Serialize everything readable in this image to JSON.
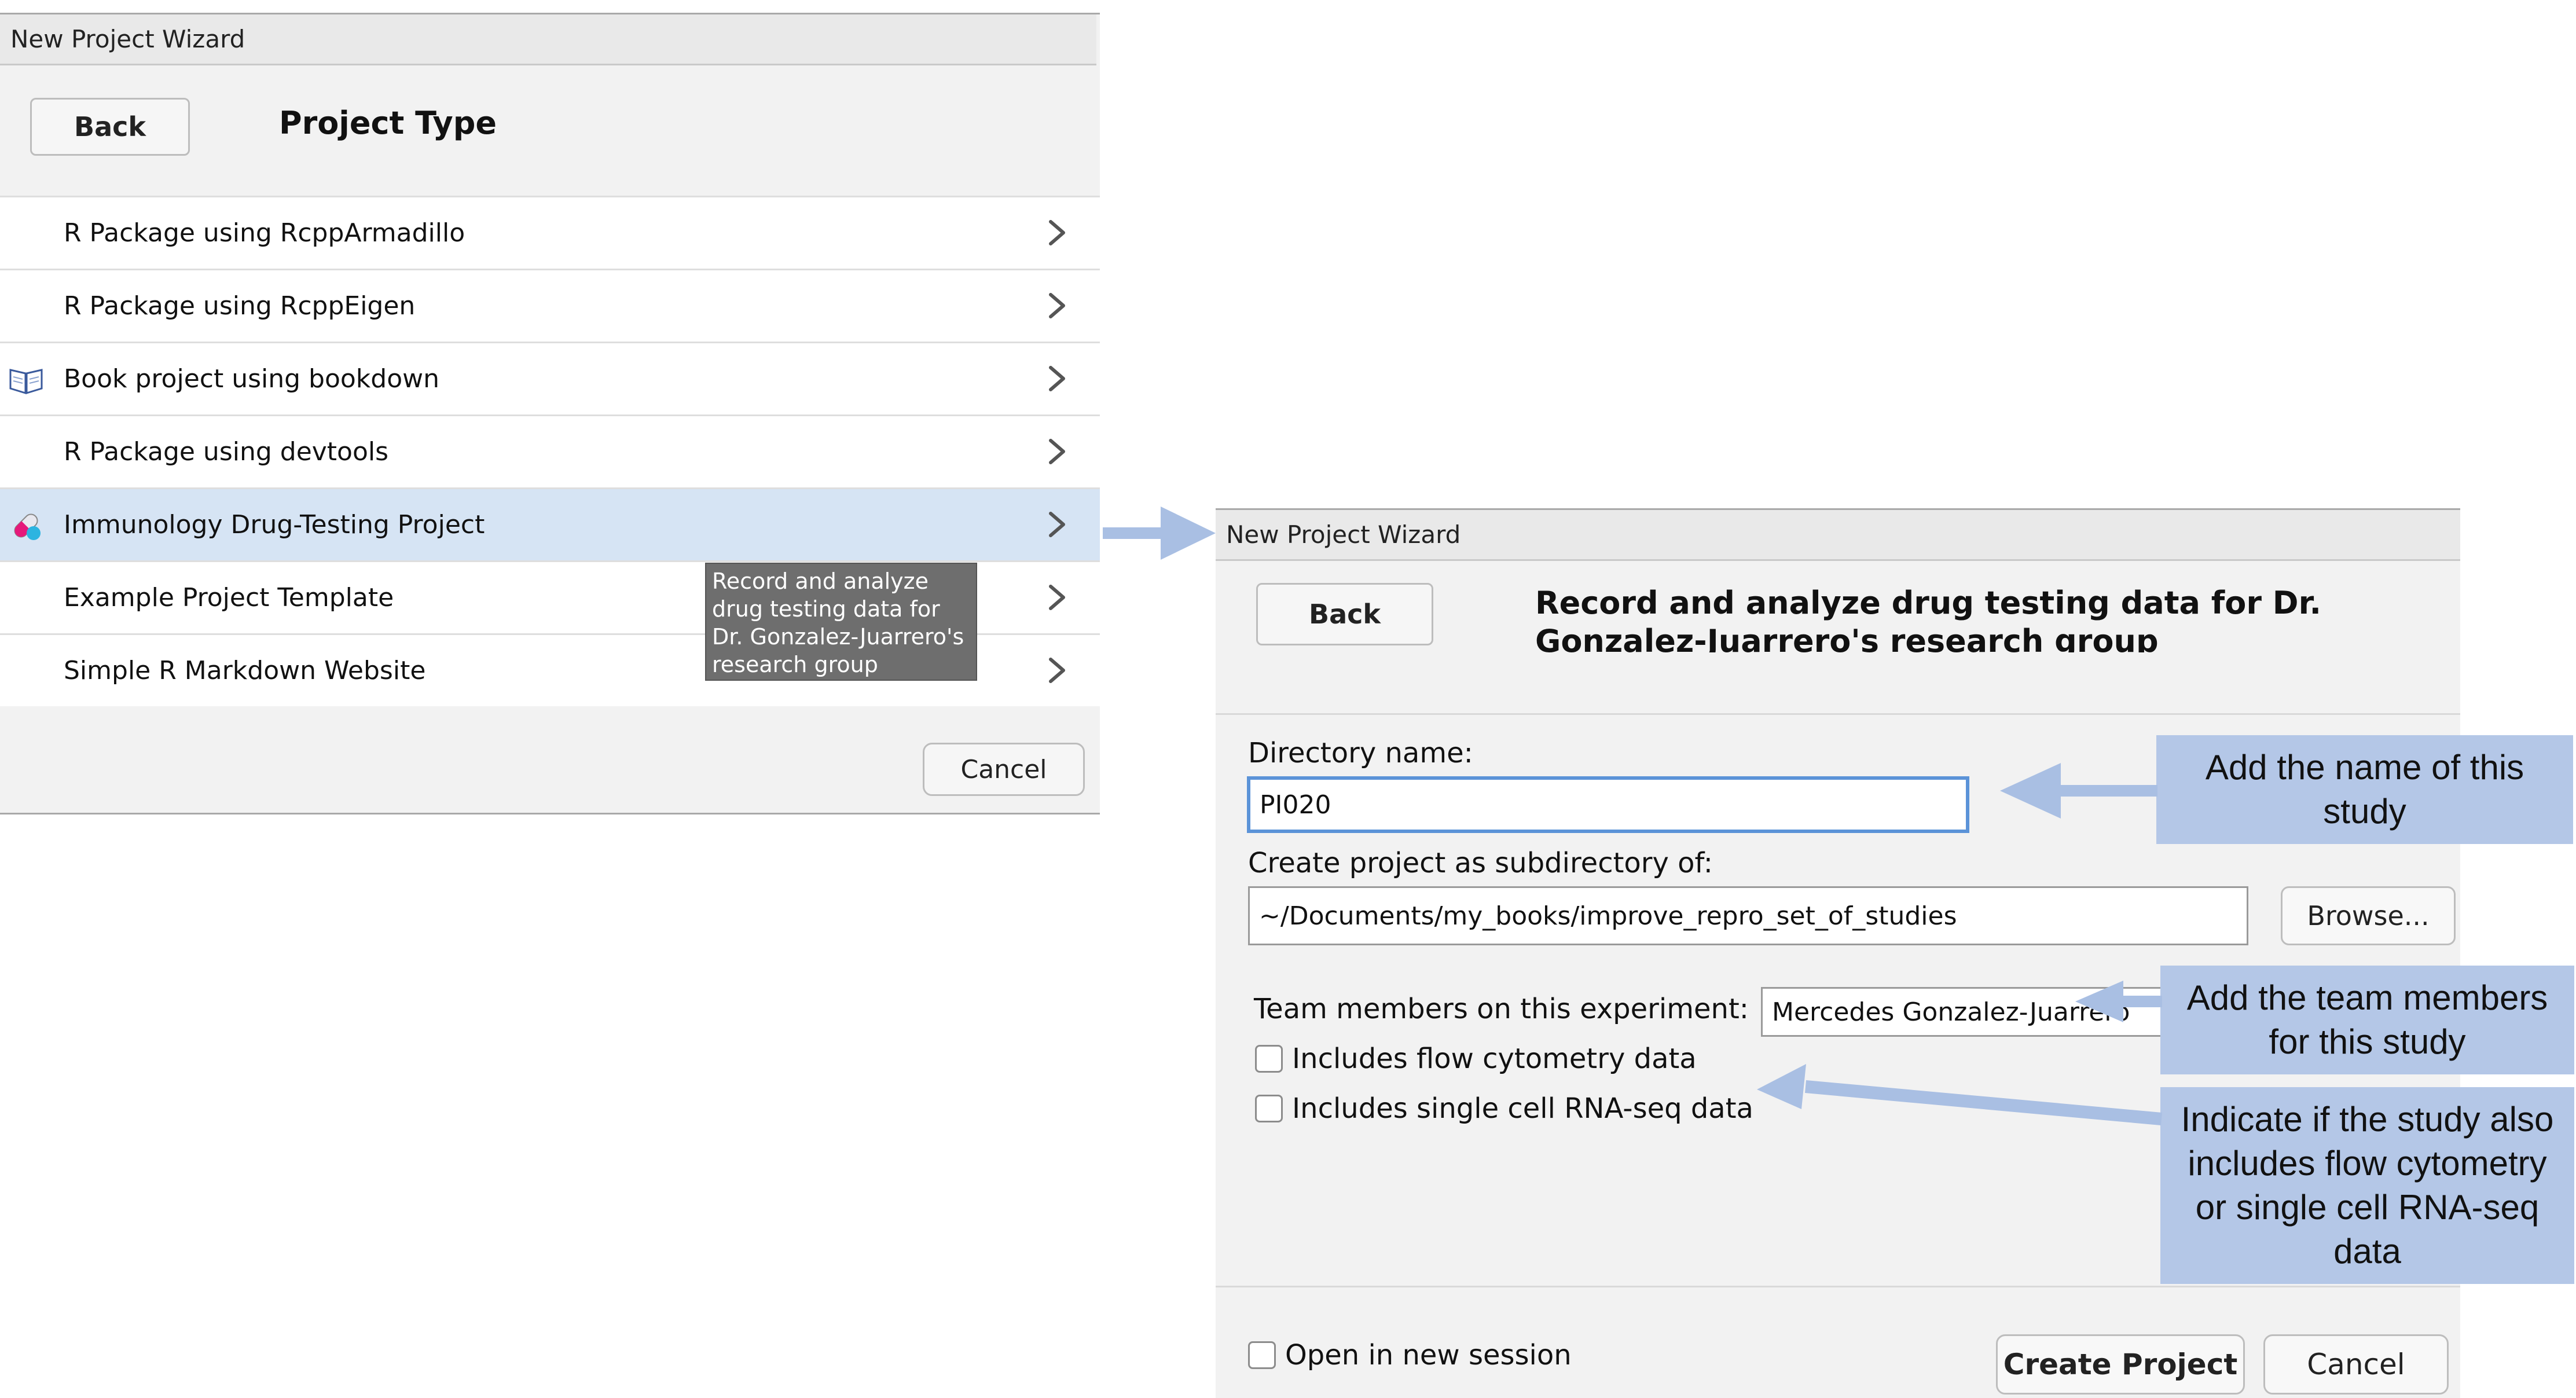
{
  "left_wizard": {
    "window_title": "New Project Wizard",
    "back_label": "Back",
    "heading": "Project Type",
    "items": [
      {
        "label": "R Package using RcppArmadillo",
        "icon": ""
      },
      {
        "label": "R Package using RcppEigen",
        "icon": ""
      },
      {
        "label": "Book project using bookdown",
        "icon": "book-icon"
      },
      {
        "label": "R Package using devtools",
        "icon": ""
      },
      {
        "label": "Immunology Drug-Testing Project",
        "icon": "capsule-icon",
        "selected": true
      },
      {
        "label": "Example Project Template",
        "icon": ""
      },
      {
        "label": "Simple R Markdown Website",
        "icon": ""
      }
    ],
    "tooltip": "Record and analyze drug testing data for Dr. Gonzalez-Juarrero's research group",
    "cancel_label": "Cancel"
  },
  "right_wizard": {
    "window_title": "New Project Wizard",
    "back_label": "Back",
    "heading": "Record and analyze drug testing data for Dr. Gonzalez-Juarrero's research group",
    "directory_label": "Directory name:",
    "directory_value": "PI020",
    "subdir_label": "Create project as subdirectory of:",
    "subdir_value": "~/Documents/my_books/improve_repro_set_of_studies",
    "browse_label": "Browse...",
    "team_label": "Team members on this experiment:",
    "team_value": "Mercedes Gonzalez-Juarrero",
    "flow_label": "Includes flow cytometry data",
    "scrna_label": "Includes single cell RNA-seq data",
    "new_session_label": "Open in new session",
    "create_label": "Create Project",
    "cancel_label": "Cancel"
  },
  "annotations": {
    "name_callout": "Add the name of this study",
    "team_callout": "Add the team members for this study",
    "data_callout": "Indicate if the study also includes flow cytometry or single cell RNA-seq data"
  },
  "colors": {
    "selected_row": "#d6e4f4",
    "callout_fill": "#b4c7e7",
    "arrow": "#a9bfe3",
    "focus_ring": "#5b93d8",
    "tooltip_bg": "#6e6e6e"
  }
}
